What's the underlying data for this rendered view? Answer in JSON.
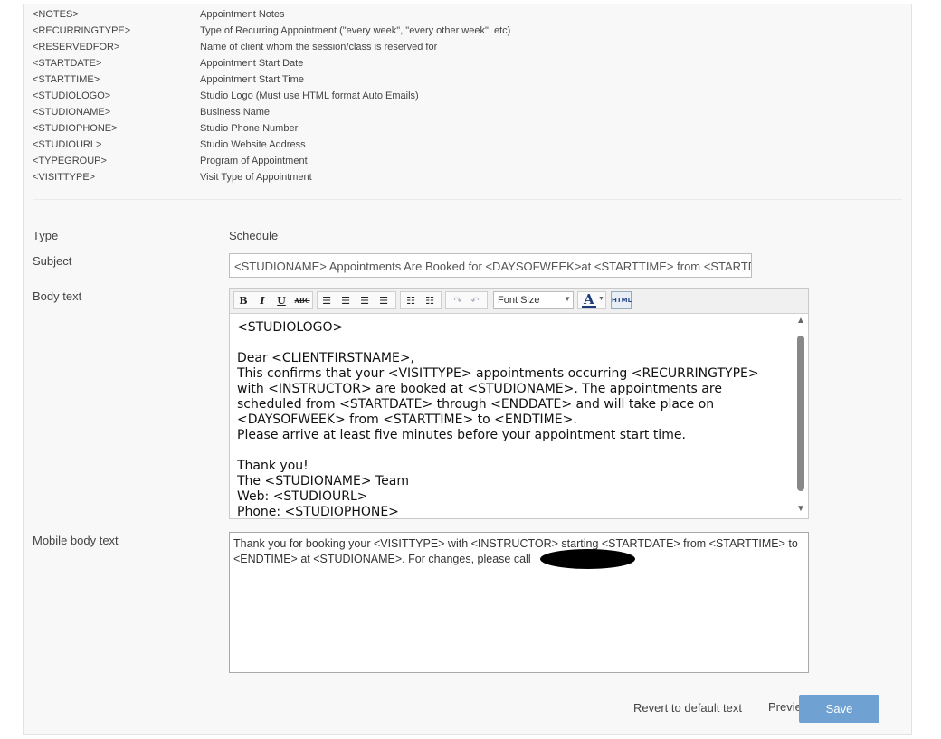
{
  "placeholders": [
    {
      "tag": "<NOTES>",
      "desc": "Appointment Notes"
    },
    {
      "tag": "<RECURRINGTYPE>",
      "desc": "Type of Recurring Appointment (\"every week\", \"every other week\", etc)"
    },
    {
      "tag": "<RESERVEDFOR>",
      "desc": "Name of client whom the session/class is reserved for"
    },
    {
      "tag": "<STARTDATE>",
      "desc": "Appointment Start Date"
    },
    {
      "tag": "<STARTTIME>",
      "desc": "Appointment Start Time"
    },
    {
      "tag": "<STUDIOLOGO>",
      "desc": "Studio Logo (Must use HTML format Auto Emails)"
    },
    {
      "tag": "<STUDIONAME>",
      "desc": "Business Name"
    },
    {
      "tag": "<STUDIOPHONE>",
      "desc": "Studio Phone Number"
    },
    {
      "tag": "<STUDIOURL>",
      "desc": "Studio Website Address"
    },
    {
      "tag": "<TYPEGROUP>",
      "desc": "Program of Appointment"
    },
    {
      "tag": "<VISITTYPE>",
      "desc": "Visit Type of Appointment"
    }
  ],
  "form": {
    "type_label": "Type",
    "type_value": "Schedule",
    "subject_label": "Subject",
    "subject_value": "<STUDIONAME> Appointments Are Booked for <DAYSOFWEEK>at <STARTTIME> from <STARTDATE> through <ENDDATE>",
    "body_label": "Body text",
    "mobile_label": "Mobile body text"
  },
  "toolbar": {
    "bold": "B",
    "italic": "I",
    "underline": "U",
    "strike": "ABC",
    "font_size": "Font Size",
    "color_letter": "A",
    "html": "HTML"
  },
  "body_lines": [
    "<STUDIOLOGO>",
    "",
    "Dear <CLIENTFIRSTNAME>,",
    "This confirms that your <VISITTYPE> appointments occurring <RECURRINGTYPE>",
    "with <INSTRUCTOR> are booked at <STUDIONAME>. The appointments are",
    "scheduled from <STARTDATE> through <ENDDATE> and will take place on",
    "<DAYSOFWEEK> from <STARTTIME> to <ENDTIME>.",
    "Please arrive at least five minutes before your appointment start time.",
    "",
    "Thank you!",
    "The <STUDIONAME> Team",
    "Web: <STUDIOURL>",
    "Phone: <STUDIOPHONE>"
  ],
  "mobile_text": "Thank you for booking your <VISITTYPE> with <INSTRUCTOR> starting <STARTDATE> from <STARTTIME> to <ENDTIME> at <STUDIONAME>. For changes, please call",
  "footer": {
    "revert": "Revert to default text",
    "preview": "Preview",
    "save": "Save"
  }
}
